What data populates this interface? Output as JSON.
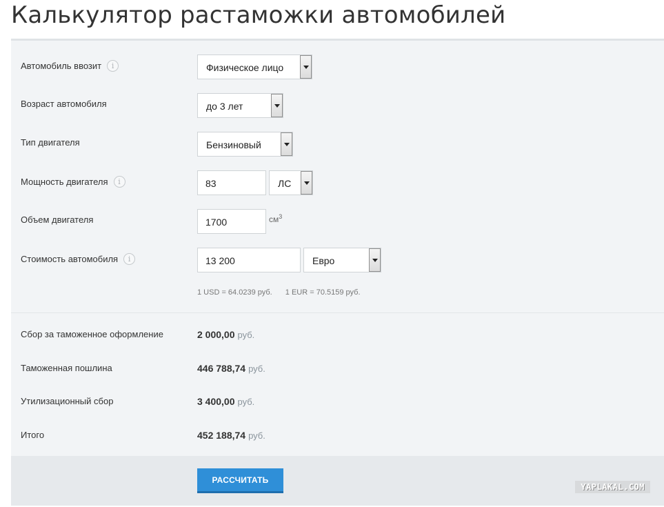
{
  "title": "Калькулятор растаможки автомобилей",
  "form": {
    "importer": {
      "label": "Автомобиль ввозит",
      "value": "Физическое лицо"
    },
    "age": {
      "label": "Возраст автомобиля",
      "value": "до 3 лет"
    },
    "engine_type": {
      "label": "Тип двигателя",
      "value": "Бензиновый"
    },
    "power": {
      "label": "Мощность двигателя",
      "value": "83",
      "unit": "ЛС"
    },
    "volume": {
      "label": "Объем двигателя",
      "value": "1700",
      "unit": "см",
      "unit_sup": "3"
    },
    "price": {
      "label": "Стоимость автомобиля",
      "value": "13 200",
      "currency": "Евро"
    },
    "rate_usd": "1 USD = 64.0239 руб.",
    "rate_eur": "1 EUR = 70.5159 руб."
  },
  "results": {
    "fee": {
      "label": "Сбор за таможенное оформление",
      "value": "2 000,00",
      "currency": "руб."
    },
    "duty": {
      "label": "Таможенная пошлина",
      "value": "446 788,74",
      "currency": "руб."
    },
    "recycling": {
      "label": "Утилизационный сбор",
      "value": "3 400,00",
      "currency": "руб."
    },
    "total": {
      "label": "Итого",
      "value": "452 188,74",
      "currency": "руб."
    }
  },
  "buttons": {
    "calculate": "РАССЧИТАТЬ"
  },
  "info_glyph": "i",
  "watermark": "YAPLAKAL.COM",
  "colors": {
    "button": "#2f8fd8",
    "panel": "#f2f4f6",
    "footer": "#e6e9ec"
  }
}
